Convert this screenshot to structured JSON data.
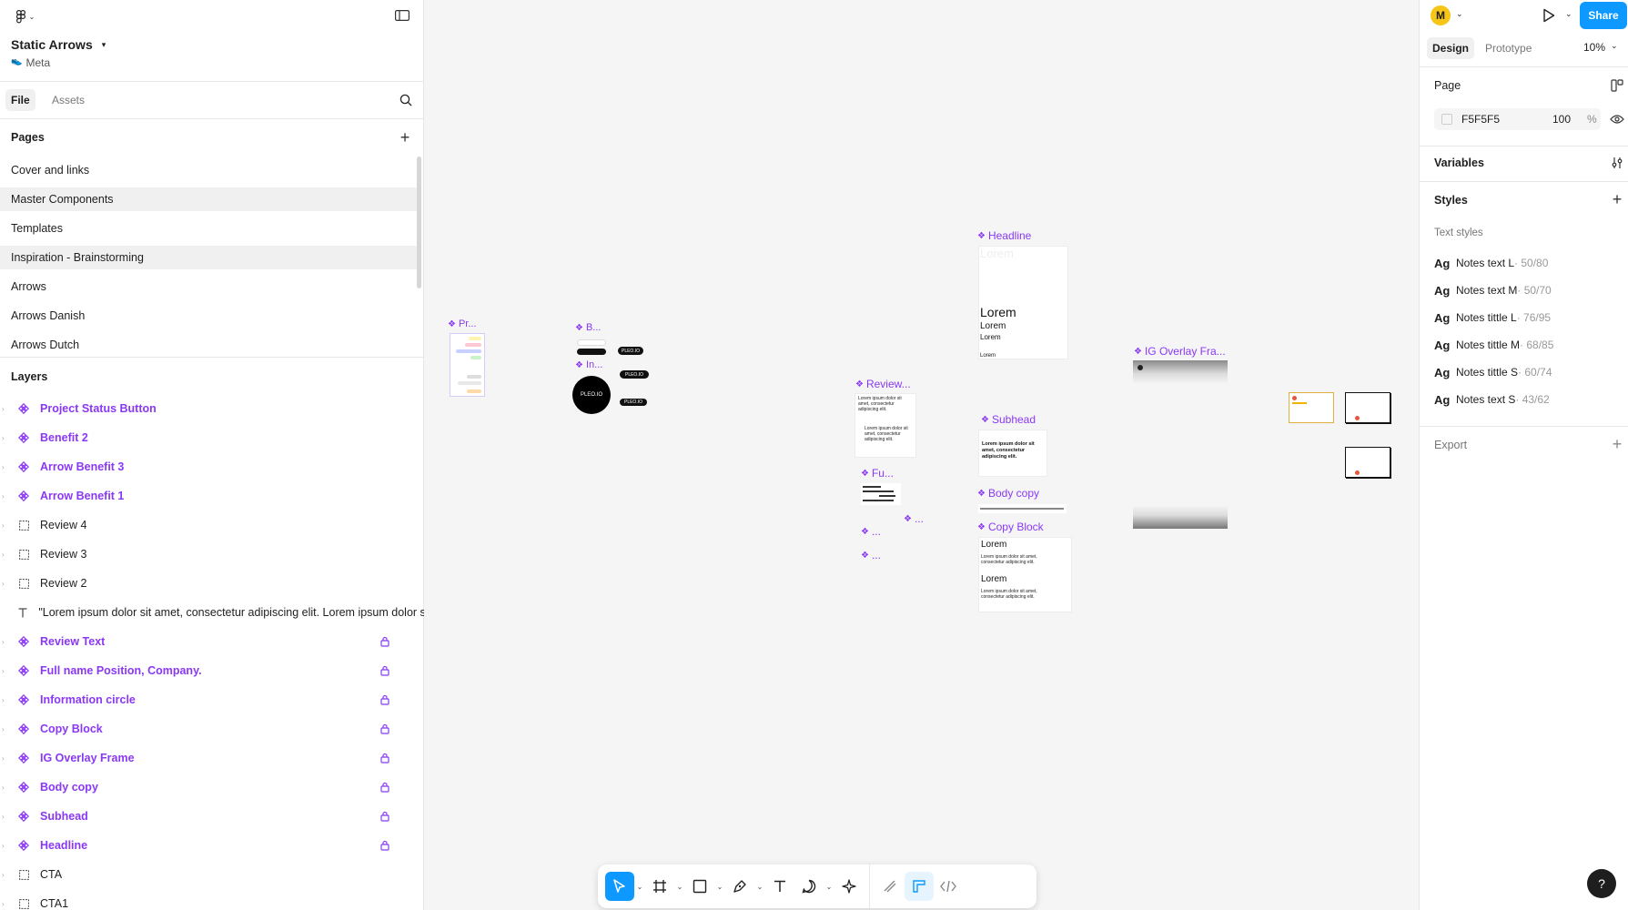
{
  "file": {
    "title": "Static Arrows",
    "project": "Meta",
    "project_emoji": "👟"
  },
  "tabs": {
    "file": "File",
    "assets": "Assets"
  },
  "pages": {
    "title": "Pages",
    "items": [
      "Cover and links",
      "Master Components",
      "Templates",
      "Inspiration - Brainstorming",
      "Arrows",
      "Arrows  Danish",
      "Arrows  Dutch"
    ]
  },
  "layers": {
    "title": "Layers",
    "items": [
      {
        "name": "Project Status Button",
        "type": "component",
        "locked": false
      },
      {
        "name": "Benefit 2",
        "type": "component",
        "locked": false
      },
      {
        "name": "Arrow Benefit 3",
        "type": "component",
        "locked": false
      },
      {
        "name": "Arrow Benefit 1",
        "type": "component",
        "locked": false
      },
      {
        "name": "Review 4",
        "type": "frame",
        "locked": false
      },
      {
        "name": "Review 3",
        "type": "frame",
        "locked": false
      },
      {
        "name": "Review 2",
        "type": "frame",
        "locked": false
      },
      {
        "name": "\"Lorem ipsum dolor sit amet, consectetur adipiscing elit. Lorem ipsum dolor sit am",
        "type": "text",
        "locked": false
      },
      {
        "name": "Review Text",
        "type": "component",
        "locked": true
      },
      {
        "name": "Full name Position, Company.",
        "type": "component",
        "locked": true
      },
      {
        "name": "Information circle",
        "type": "component",
        "locked": true
      },
      {
        "name": "Copy Block",
        "type": "component",
        "locked": true
      },
      {
        "name": "IG Overlay Frame",
        "type": "component",
        "locked": true
      },
      {
        "name": "Body copy",
        "type": "component",
        "locked": true
      },
      {
        "name": "Subhead",
        "type": "component",
        "locked": true
      },
      {
        "name": "Headline",
        "type": "component",
        "locked": true
      },
      {
        "name": "CTA",
        "type": "frame",
        "locked": false
      },
      {
        "name": "CTA1",
        "type": "frame",
        "locked": false
      }
    ]
  },
  "right": {
    "avatar": "M",
    "share": "Share",
    "tabs": {
      "design": "Design",
      "prototype": "Prototype"
    },
    "zoom": "10%",
    "page_title": "Page",
    "page_color": "F5F5F5",
    "page_opacity": "100",
    "percent": "%",
    "variables": "Variables",
    "styles": "Styles",
    "text_styles": "Text styles",
    "text_style_items": [
      {
        "name": "Notes text L",
        "meta": " · 50/80"
      },
      {
        "name": "Notes text M",
        "meta": " · 50/70"
      },
      {
        "name": "Notes tittle L",
        "meta": " · 76/95"
      },
      {
        "name": "Notes tittle M",
        "meta": " · 68/85"
      },
      {
        "name": "Notes tittle S",
        "meta": " · 60/74"
      },
      {
        "name": "Notes text S",
        "meta": " · 43/62"
      }
    ],
    "ag": "Ag",
    "export": "Export"
  },
  "canvas": {
    "labels": {
      "pr": "Pr...",
      "b": "B...",
      "in": "In...",
      "headline": "Headline",
      "review": "Review...",
      "ig": "IG Overlay Fra...",
      "subhead": "Subhead",
      "fu": "Fu...",
      "body": "Body copy",
      "dots": "...",
      "copy_block": "Copy Block"
    },
    "lorem": "Lorem",
    "pleo": "PLEO.IO",
    "lorem_bold": "Lorem ipsum dolor sit amet, consectetur adipiscing elit.",
    "lorem_small": "Lorem ipsum dolor sit amet, consectetur adipiscing elit."
  },
  "colors": {
    "accent": "#0d99ff",
    "component": "#8a38f5",
    "canvas": "#f5f5f5"
  }
}
